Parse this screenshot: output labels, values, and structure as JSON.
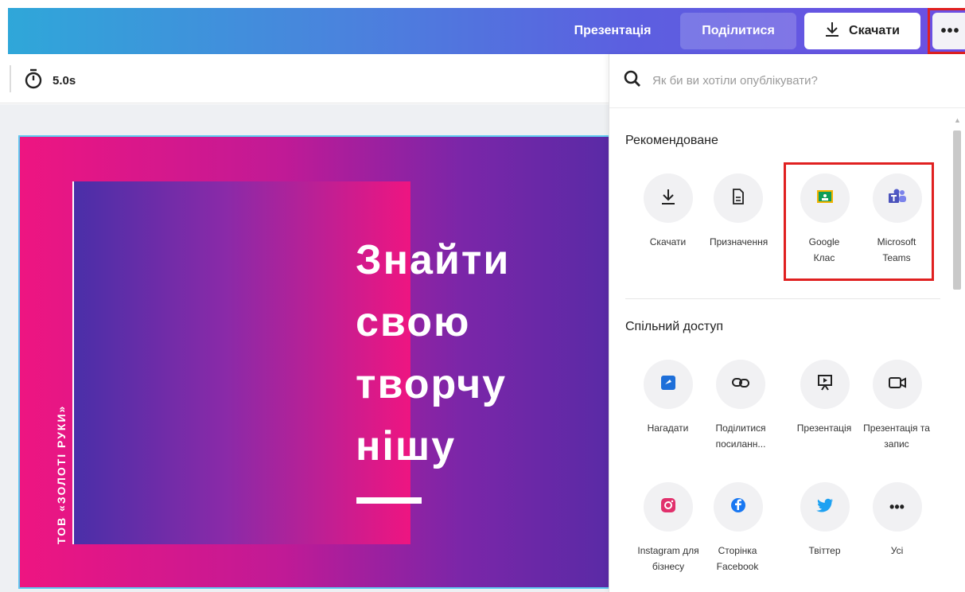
{
  "topbar": {
    "present_label": "Презентація",
    "share_label": "Поділитися",
    "download_label": "Скачати",
    "more_label": "•••"
  },
  "editor": {
    "timer_value": "5.0s"
  },
  "slide": {
    "vertical_text": "ТОВ «ЗОЛОТІ РУКИ»",
    "headline": [
      "Знайти",
      "свою",
      "творчу",
      "нішу"
    ]
  },
  "panel": {
    "search_placeholder": "Як би ви хотіли опублікувати?",
    "recommended_title": "Рекомендоване",
    "recommended": [
      {
        "label": "Скачати",
        "icon": "download-icon"
      },
      {
        "label": "Призначення",
        "icon": "document-icon"
      },
      {
        "label": "Google Клас",
        "icon": "google-classroom-icon"
      },
      {
        "label": "Microsoft Teams",
        "icon": "microsoft-teams-icon"
      }
    ],
    "sharing_title": "Спільний доступ",
    "sharing": [
      {
        "label": "Нагадати",
        "icon": "reminder-icon"
      },
      {
        "label": "Поділитися посиланн...",
        "icon": "link-icon"
      },
      {
        "label": "Презентація",
        "icon": "presentation-icon"
      },
      {
        "label": "Презентація та запис",
        "icon": "record-icon"
      },
      {
        "label": "Instagram для бізнесу",
        "icon": "instagram-icon"
      },
      {
        "label": "Сторінка Facebook",
        "icon": "facebook-icon"
      },
      {
        "label": "Твіттер",
        "icon": "twitter-icon"
      },
      {
        "label": "Усі",
        "icon": "more-icon"
      }
    ]
  },
  "colors": {
    "highlight": "#e02020",
    "accent": "#5c5fe0",
    "slide_pink": "#ee1581",
    "slide_purple": "#5a2aa6"
  }
}
